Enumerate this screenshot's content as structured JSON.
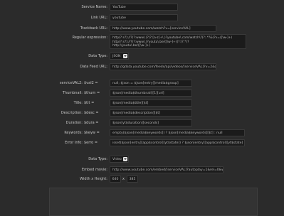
{
  "form": {
    "service_name": {
      "label": "Service Name:",
      "value": "YouTube"
    },
    "link_url": {
      "label": "Link URL:",
      "value": "youtube"
    },
    "trackback_url": {
      "label": "Trackback URL:",
      "value": "http://www.youtube.com/watch?v=[serviceVAL]"
    },
    "regex": {
      "label": "Regular expression:",
      "lines": [
        "http(?:s?)://?(?:www\\.)?(?:[a-z]+\\.)?youtube\\.com/watch\\?(?:.*?&)?v=([\\w-]+)",
        "http(?:s?)://?(?:www\\.)?youtu\\.be/([\\w-]+)(?:\\?.*)?",
        "http://youtu\\.be/([\\w-]+)"
      ]
    },
    "data_type_1": {
      "label": "Data Type:",
      "value": "JSON"
    },
    "data_feed_url": {
      "label": "Data Feed URL:",
      "value": "http://gdata.youtube.com/feeds/api/videos/[serviceVAL]?v=2&alt=json"
    },
    "fields": [
      {
        "label": "serviceVAL2:",
        "var": "$val2 =",
        "value": "null; $json = $json[entry][media$group]"
      },
      {
        "label": "Thumbnail:",
        "var": "$thum =",
        "value": "$json[media$thumbnail][1][url]"
      },
      {
        "label": "Title:",
        "var": "$tit =",
        "value": "$json[media$title][$t]"
      },
      {
        "label": "Description:",
        "var": "$desc =",
        "value": "$json[media$description][$t]"
      },
      {
        "label": "Duration:",
        "var": "$dura =",
        "value": "$json[yt$duration][seconds]"
      },
      {
        "label": "Keywords:",
        "var": "$keyw =",
        "value": "empty($json[media$keywords]) ? $json[media$keywords][$t] : null"
      },
      {
        "label": "Error Info:",
        "var": "$erro =",
        "value": "isset($json[entry][app$control][yt$state]) ? $json[entry][app$control][yt$state]"
      }
    ],
    "data_type_2": {
      "label": "Data Type:",
      "value": "Video"
    },
    "embed_movie": {
      "label": "Embed movie:",
      "value": "http://www.youtube.com/embed/[serviceVAL]?autoplay=1&rel=0&width=580&height=0"
    },
    "size": {
      "label": "Width x Height:",
      "width": "640",
      "sep": "x",
      "height": "385"
    }
  }
}
